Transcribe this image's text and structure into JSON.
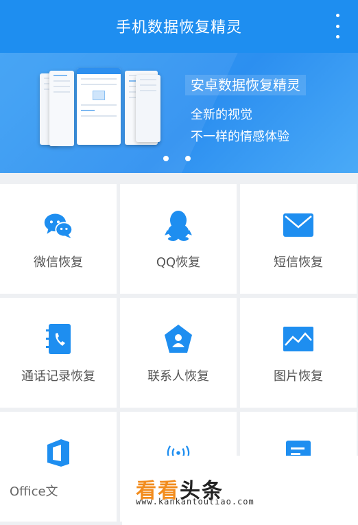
{
  "appbar": {
    "title": "手机数据恢复精灵"
  },
  "banner": {
    "headline": "安卓数据恢复精灵",
    "line1": "全新的视觉",
    "line2": "不一样的情感体验"
  },
  "tiles": [
    {
      "label": "微信恢复",
      "icon": "wechat-icon"
    },
    {
      "label": "QQ恢复",
      "icon": "qq-icon"
    },
    {
      "label": "短信恢复",
      "icon": "sms-icon"
    },
    {
      "label": "通话记录恢复",
      "icon": "call-log-icon"
    },
    {
      "label": "联系人恢复",
      "icon": "contacts-icon"
    },
    {
      "label": "图片恢复",
      "icon": "image-icon"
    },
    {
      "label": "Office文",
      "icon": "office-icon"
    },
    {
      "label": "",
      "icon": "audio-icon"
    },
    {
      "label": "",
      "icon": "document-icon"
    }
  ],
  "watermark": {
    "brand_a": "看看",
    "brand_b": "头条",
    "url": "www.kankantoutiao.com"
  },
  "colors": {
    "primary": "#1e8ef0",
    "icon_blue": "#1e8ef0",
    "brand_orange": "#f28c1d"
  }
}
